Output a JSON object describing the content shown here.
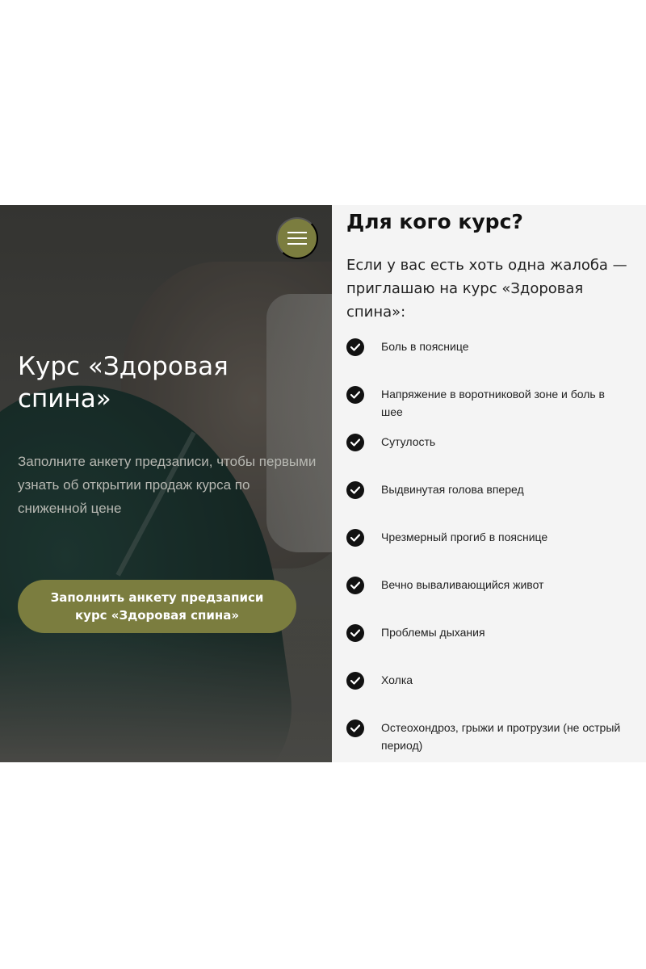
{
  "hero": {
    "menu_icon": "hamburger-menu-icon",
    "title": "Курс «Здоровая спина»",
    "subtitle": "Заполните анкету предзаписи, чтобы первыми узнать об открытии продаж курса по сниженной цене",
    "cta_label": "Заполнить анкету предзаписи\nкурс «Здоровая спина»",
    "accent_color": "#7b7d3f"
  },
  "audience": {
    "title": "Для кого курс?",
    "intro": "Если у вас есть хоть одна жалоба — приглашаю на курс «Здоровая спина»:",
    "check_icon": "check-circle-icon",
    "items": [
      "Боль в пояснице",
      "Напряжение в воротниковой зоне и боль в шее",
      "Сутулость",
      "Выдвинутая голова вперед",
      "Чрезмерный прогиб в пояснице",
      "Вечно вываливающийся живот",
      "Проблемы дыхания",
      "Холка",
      "Остеохондроз, грыжи и протрузии (не острый период)"
    ]
  }
}
